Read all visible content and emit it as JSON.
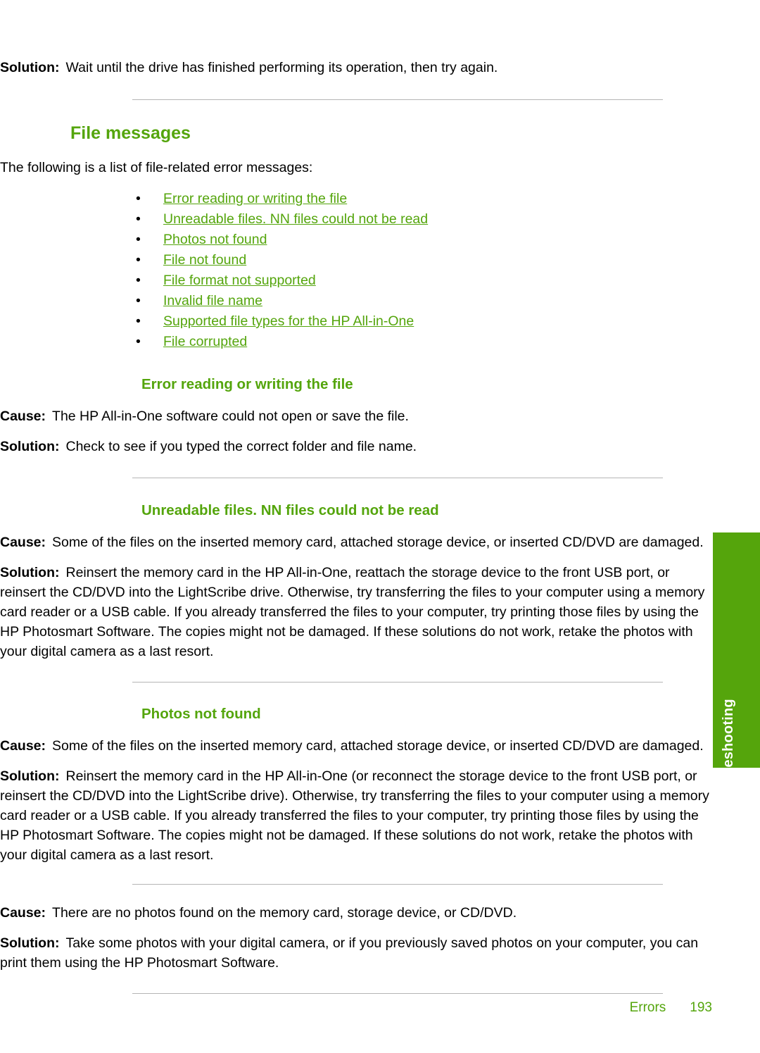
{
  "page": {
    "top_solution": {
      "label": "Solution:",
      "text": "Wait until the drive has finished performing its operation, then try again."
    },
    "section": {
      "title": "File messages",
      "intro": "The following is a list of file-related error messages:",
      "links": [
        "Error reading or writing the file",
        "Unreadable files. NN files could not be read",
        "Photos not found",
        "File not found",
        "File format not supported",
        "Invalid file name",
        "Supported file types for the HP All-in-One",
        "File corrupted"
      ],
      "bullet_glyph": "•"
    },
    "subsections": [
      {
        "title": "Error reading or writing the file",
        "entries": [
          {
            "label": "Cause:",
            "text": "The HP All-in-One software could not open or save the file."
          },
          {
            "label": "Solution:",
            "text": "Check to see if you typed the correct folder and file name."
          }
        ]
      },
      {
        "title": "Unreadable files. NN files could not be read",
        "entries": [
          {
            "label": "Cause:",
            "text": "Some of the files on the inserted memory card, attached storage device, or inserted CD/DVD are damaged."
          },
          {
            "label": "Solution:",
            "text": "Reinsert the memory card in the HP All-in-One, reattach the storage device to the front USB port, or reinsert the CD/DVD into the LightScribe drive. Otherwise, try transferring the files to your computer using a memory card reader or a USB cable. If you already transferred the files to your computer, try printing those files by using the HP Photosmart Software. The copies might not be damaged. If these solutions do not work, retake the photos with your digital camera as a last resort."
          }
        ]
      },
      {
        "title": "Photos not found",
        "entries": [
          {
            "label": "Cause:",
            "text": "Some of the files on the inserted memory card, attached storage device, or inserted CD/DVD are damaged."
          },
          {
            "label": "Solution:",
            "text": "Reinsert the memory card in the HP All-in-One (or reconnect the storage device to the front USB port, or reinsert the CD/DVD into the LightScribe drive). Otherwise, try transferring the files to your computer using a memory card reader or a USB cable. If you already transferred the files to your computer, try printing those files by using the HP Photosmart Software. The copies might not be damaged. If these solutions do not work, retake the photos with your digital camera as a last resort."
          },
          {
            "label": "Cause:",
            "text": "There are no photos found on the memory card, storage device, or CD/DVD."
          },
          {
            "label": "Solution:",
            "text": "Take some photos with your digital camera, or if you previously saved photos on your computer, you can print them using the HP Photosmart Software."
          }
        ]
      }
    ],
    "thumb_tab": {
      "label": "Troubleshooting"
    },
    "footer": {
      "chapter": "Errors",
      "page_number": "193"
    },
    "colors": {
      "green": "#54a50c",
      "tab_green": "#55a50c",
      "rule": "#b5b5b5"
    }
  }
}
